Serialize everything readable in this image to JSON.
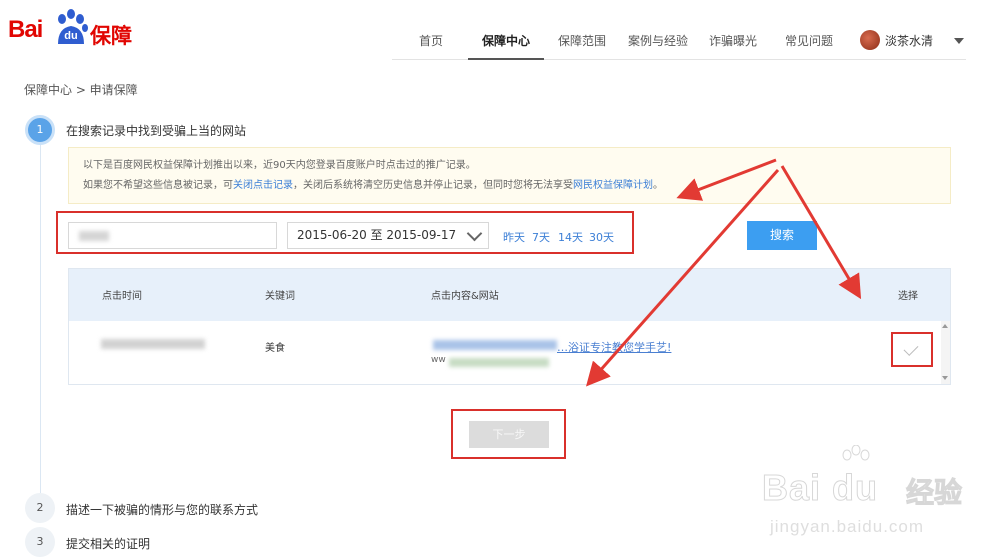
{
  "brand": {
    "logo_prefix": "Bai",
    "logo_du": "du",
    "logo_suffix": "保障"
  },
  "nav": {
    "items": [
      "首页",
      "保障中心",
      "保障范围",
      "案例与经验",
      "诈骗曝光",
      "常见问题"
    ],
    "active_index": 1,
    "username": "淡茶水清"
  },
  "breadcrumb": "保障中心 > 申请保障",
  "steps": [
    {
      "num": "1",
      "title": "在搜索记录中找到受骗上当的网站"
    },
    {
      "num": "2",
      "title": "描述一下被骗的情形与您的联系方式"
    },
    {
      "num": "3",
      "title": "提交相关的证明"
    }
  ],
  "notice": {
    "line1": "以下是百度网民权益保障计划推出以来，近90天内您登录百度账户时点击过的推广记录。",
    "line2_prefix": "如果您不希望这些信息被记录，可",
    "line2_link1": "关闭点击记录",
    "line2_middle": "，关闭后系统将清空历史信息并停止记录，但同时您将无法享受",
    "line2_link2": "网民权益保障计划",
    "line2_suffix": "。"
  },
  "filter": {
    "date_range": "2015-06-20 至 2015-09-17",
    "quick_ranges": [
      "昨天",
      "7天",
      "14天",
      "30天"
    ],
    "search_button": "搜索"
  },
  "table": {
    "headers": [
      "点击时间",
      "关键词",
      "点击内容&网站",
      "选择"
    ],
    "rows": [
      {
        "keyword": "美食",
        "link_tail": "…浴证专注教您学手艺!",
        "url_prefix": "ww"
      }
    ]
  },
  "next_button": "下一步",
  "watermark": {
    "brand": "Bai du",
    "jingyan": "经验",
    "url": "jingyan.baidu.com"
  },
  "colors": {
    "brand_red": "#e10602",
    "accent_blue": "#3c9ef1",
    "annotation_red": "#d9302b"
  }
}
